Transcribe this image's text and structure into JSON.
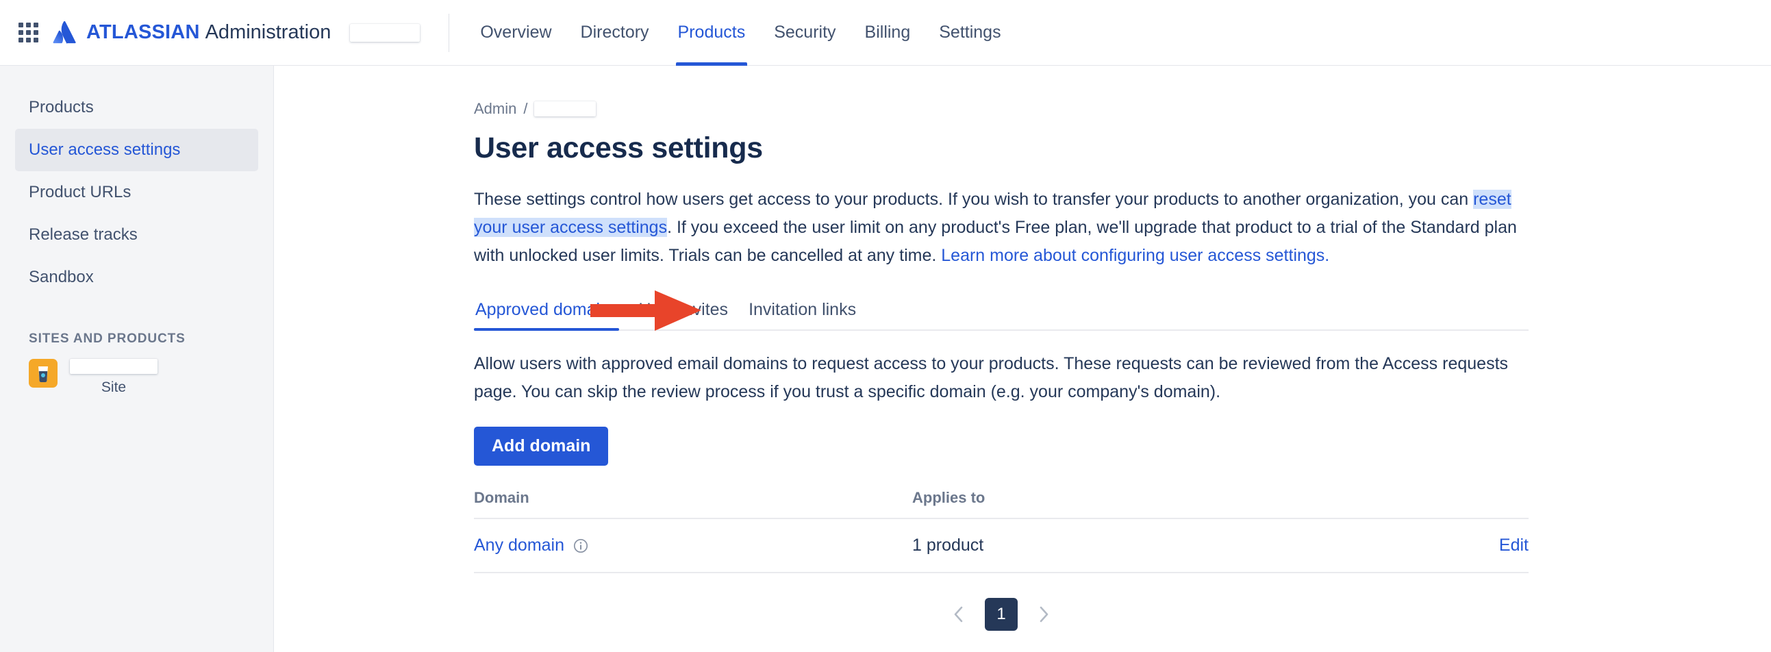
{
  "header": {
    "app_switcher_icon": "grid-apps-icon",
    "logo_icon": "atlassian-logo-icon",
    "brand": "ATLASSIAN",
    "brand_sub": "Administration",
    "org_name_redacted": "",
    "nav": [
      {
        "label": "Overview",
        "active": false
      },
      {
        "label": "Directory",
        "active": false
      },
      {
        "label": "Products",
        "active": true
      },
      {
        "label": "Security",
        "active": false
      },
      {
        "label": "Billing",
        "active": false
      },
      {
        "label": "Settings",
        "active": false
      }
    ]
  },
  "sidebar": {
    "items": [
      {
        "label": "Products",
        "active": false
      },
      {
        "label": "User access settings",
        "active": true
      },
      {
        "label": "Product URLs",
        "active": false
      },
      {
        "label": "Release tracks",
        "active": false
      },
      {
        "label": "Sandbox",
        "active": false
      }
    ],
    "section_title": "SITES AND PRODUCTS",
    "site": {
      "icon": "confluence-site-icon",
      "name_redacted": "",
      "label": "Site"
    }
  },
  "breadcrumb": {
    "root": "Admin",
    "separator": "/",
    "current_redacted": ""
  },
  "page": {
    "title": "User access settings",
    "intro": {
      "part1": "These settings control how users get access to your products. If you wish to transfer your products to another organization, you can ",
      "highlighted_link": "reset your user access settings",
      "part2": ". If you exceed the user limit on any product's Free plan, we'll upgrade that product to a trial of the Standard plan with unlocked user limits. Trials can be cancelled at any time. ",
      "learn_more_link": "Learn more about configuring user access settings."
    }
  },
  "tabs": [
    {
      "label": "Approved domains",
      "active": true
    },
    {
      "label": "User invites",
      "active": false
    },
    {
      "label": "Invitation links",
      "active": false
    }
  ],
  "approved_domains": {
    "description": "Allow users with approved email domains to request access to your products. These requests can be reviewed from the Access requests page. You can skip the review process if you trust a specific domain (e.g. your company's domain).",
    "add_button": "Add domain",
    "columns": {
      "domain": "Domain",
      "applies_to": "Applies to"
    },
    "rows": [
      {
        "domain": "Any domain",
        "info_icon": "info-circle-icon",
        "applies_to": "1 product",
        "action": "Edit"
      }
    ]
  },
  "pagination": {
    "prev_icon": "chevron-left-icon",
    "next_icon": "chevron-right-icon",
    "current_page": "1"
  },
  "annotation": {
    "arrow_icon": "red-arrow-right-icon",
    "color": "#e8442a"
  },
  "colors": {
    "accent_blue": "#2557d6",
    "text_dark": "#253858",
    "text_muted": "#6b778c",
    "sidebar_bg": "#f4f5f7",
    "selection_bg": "#cfe0fb",
    "site_icon_bg": "#f5a828",
    "pager_active_bg": "#253858"
  }
}
